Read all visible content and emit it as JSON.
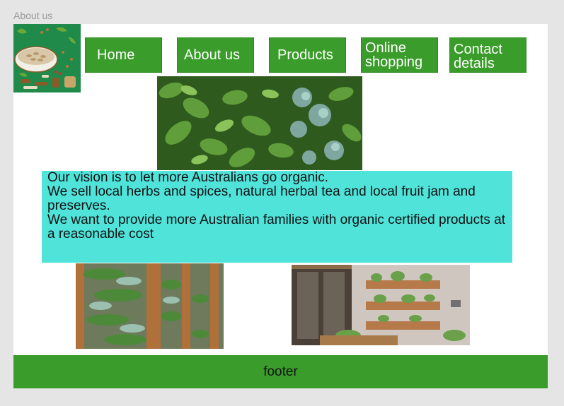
{
  "frame": {
    "label": "About us"
  },
  "nav": {
    "home": "Home",
    "about": "About us",
    "products": "Products",
    "online_shopping": "Online\nshopping",
    "contact": "Contact\ndetails"
  },
  "vision": {
    "line1": "Our vision is to let more Australians go organic.",
    "line2": "We sell local herbs and spices, natural herbal tea and local fruit jam and preserves.",
    "line3": "We want to provide more Australian families with organic certified products at a reasonable cost"
  },
  "footer": {
    "label": "footer"
  },
  "colors": {
    "nav_green": "#3a9c2a",
    "vision_cyan": "#4fe3da",
    "footer_green": "#3a9c2a",
    "canvas_gray": "#e5e5e5"
  }
}
